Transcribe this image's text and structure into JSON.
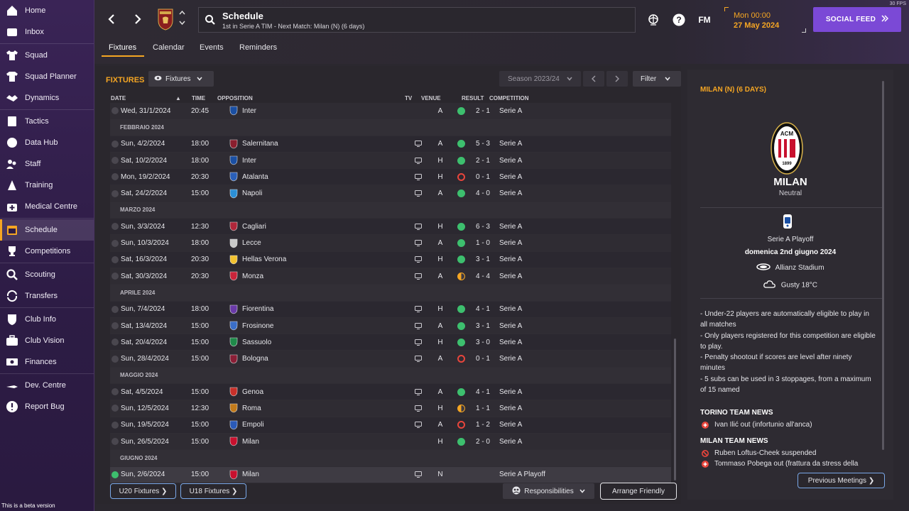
{
  "sidebar": {
    "items": [
      {
        "label": "Home",
        "icon": "home-icon"
      },
      {
        "label": "Inbox",
        "icon": "inbox-icon"
      },
      {
        "label": "Squad",
        "icon": "shirt-icon"
      },
      {
        "label": "Squad Planner",
        "icon": "planner-icon"
      },
      {
        "label": "Dynamics",
        "icon": "handshake-icon"
      },
      {
        "label": "Tactics",
        "icon": "tactics-board-icon"
      },
      {
        "label": "Data Hub",
        "icon": "data-hub-icon"
      },
      {
        "label": "Staff",
        "icon": "staff-icon"
      },
      {
        "label": "Training",
        "icon": "training-cone-icon"
      },
      {
        "label": "Medical Centre",
        "icon": "medical-kit-icon"
      },
      {
        "label": "Schedule",
        "icon": "calendar-icon"
      },
      {
        "label": "Competitions",
        "icon": "trophy-icon"
      },
      {
        "label": "Scouting",
        "icon": "magnifier-icon"
      },
      {
        "label": "Transfers",
        "icon": "transfer-arrows-icon"
      },
      {
        "label": "Club Info",
        "icon": "shield-icon"
      },
      {
        "label": "Club Vision",
        "icon": "briefcase-icon"
      },
      {
        "label": "Finances",
        "icon": "money-icon"
      },
      {
        "label": "Dev. Centre",
        "icon": "dev-centre-icon"
      },
      {
        "label": "Report Bug",
        "icon": "alert-icon"
      }
    ],
    "beta_text": "This is a beta version"
  },
  "header": {
    "title": "Schedule",
    "subtitle": "1st in Serie A TIM - Next Match: Milan (N) (6 days)",
    "fm_label": "FM",
    "time": "Mon 00:00",
    "date": "27 May 2024",
    "social_feed": "SOCIAL FEED",
    "fps": "30 FPS"
  },
  "tabs": [
    "Fixtures",
    "Calendar",
    "Events",
    "Reminders"
  ],
  "fixtures": {
    "title": "FIXTURES",
    "view_pill": "Fixtures",
    "season": "Season 2023/24",
    "filter": "Filter",
    "columns": {
      "date": "DATE",
      "time": "TIME",
      "opposition": "OPPOSITION",
      "tv": "TV",
      "venue": "VENUE",
      "result": "RESULT",
      "competition": "COMPETITION"
    },
    "rows": [
      {
        "type": "match",
        "date": "Wed, 31/1/2024",
        "time": "20:45",
        "opp": "Inter",
        "crest": "#1a4fa3",
        "tv": false,
        "venue": "A",
        "res": "win",
        "score": "2 - 1",
        "comp": "Serie A"
      },
      {
        "type": "month",
        "label": "FEBBRAIO 2024"
      },
      {
        "type": "match",
        "date": "Sun, 4/2/2024",
        "time": "18:00",
        "opp": "Salernitana",
        "crest": "#8b1e2e",
        "tv": true,
        "venue": "A",
        "res": "win",
        "score": "5 - 3",
        "comp": "Serie A"
      },
      {
        "type": "match",
        "date": "Sat, 10/2/2024",
        "time": "18:00",
        "opp": "Inter",
        "crest": "#1a4fa3",
        "tv": true,
        "venue": "H",
        "res": "win",
        "score": "2 - 1",
        "comp": "Serie A"
      },
      {
        "type": "match",
        "date": "Mon, 19/2/2024",
        "time": "20:30",
        "opp": "Atalanta",
        "crest": "#2a5fb8",
        "tv": true,
        "venue": "H",
        "res": "loss",
        "score": "0 - 1",
        "comp": "Serie A"
      },
      {
        "type": "match",
        "date": "Sat, 24/2/2024",
        "time": "15:00",
        "opp": "Napoli",
        "crest": "#2b8fd6",
        "tv": true,
        "venue": "A",
        "res": "win",
        "score": "4 - 0",
        "comp": "Serie A"
      },
      {
        "type": "month",
        "label": "MARZO 2024"
      },
      {
        "type": "match",
        "date": "Sun, 3/3/2024",
        "time": "12:30",
        "opp": "Cagliari",
        "crest": "#b0273a",
        "tv": true,
        "venue": "H",
        "res": "win",
        "score": "6 - 3",
        "comp": "Serie A"
      },
      {
        "type": "match",
        "date": "Sun, 10/3/2024",
        "time": "18:00",
        "opp": "Lecce",
        "crest": "#c9c9c9",
        "tv": true,
        "venue": "A",
        "res": "win",
        "score": "1 - 0",
        "comp": "Serie A"
      },
      {
        "type": "match",
        "date": "Sat, 16/3/2024",
        "time": "20:30",
        "opp": "Hellas Verona",
        "crest": "#f2c230",
        "tv": true,
        "venue": "H",
        "res": "win",
        "score": "3 - 1",
        "comp": "Serie A"
      },
      {
        "type": "match",
        "date": "Sat, 30/3/2024",
        "time": "20:30",
        "opp": "Monza",
        "crest": "#c8243a",
        "tv": true,
        "venue": "A",
        "res": "draw",
        "score": "4 - 4",
        "comp": "Serie A"
      },
      {
        "type": "month",
        "label": "APRILE 2024"
      },
      {
        "type": "match",
        "date": "Sun, 7/4/2024",
        "time": "18:00",
        "opp": "Fiorentina",
        "crest": "#6a3aa8",
        "tv": true,
        "venue": "H",
        "res": "win",
        "score": "4 - 1",
        "comp": "Serie A"
      },
      {
        "type": "match",
        "date": "Sat, 13/4/2024",
        "time": "15:00",
        "opp": "Frosinone",
        "crest": "#3a6ec8",
        "tv": true,
        "venue": "A",
        "res": "win",
        "score": "3 - 1",
        "comp": "Serie A"
      },
      {
        "type": "match",
        "date": "Sat, 20/4/2024",
        "time": "15:00",
        "opp": "Sassuolo",
        "crest": "#1f8a4a",
        "tv": true,
        "venue": "H",
        "res": "win",
        "score": "3 - 0",
        "comp": "Serie A"
      },
      {
        "type": "match",
        "date": "Sun, 28/4/2024",
        "time": "15:00",
        "opp": "Bologna",
        "crest": "#8a1e36",
        "tv": true,
        "venue": "A",
        "res": "loss",
        "score": "0 - 1",
        "comp": "Serie A"
      },
      {
        "type": "month",
        "label": "MAGGIO 2024"
      },
      {
        "type": "match",
        "date": "Sat, 4/5/2024",
        "time": "15:00",
        "opp": "Genoa",
        "crest": "#c8302a",
        "tv": true,
        "venue": "A",
        "res": "win",
        "score": "4 - 1",
        "comp": "Serie A"
      },
      {
        "type": "match",
        "date": "Sun, 12/5/2024",
        "time": "12:30",
        "opp": "Roma",
        "crest": "#c27a1a",
        "tv": true,
        "venue": "H",
        "res": "draw",
        "score": "1 - 1",
        "comp": "Serie A"
      },
      {
        "type": "match",
        "date": "Sun, 19/5/2024",
        "time": "15:00",
        "opp": "Empoli",
        "crest": "#2a5ab8",
        "tv": true,
        "venue": "A",
        "res": "loss",
        "score": "1 - 2",
        "comp": "Serie A"
      },
      {
        "type": "match",
        "date": "Sun, 26/5/2024",
        "time": "15:00",
        "opp": "Milan",
        "crest": "#c8102e",
        "tv": false,
        "venue": "H",
        "res": "win",
        "score": "2 - 0",
        "comp": "Serie A"
      },
      {
        "type": "month",
        "label": "GIUGNO 2024"
      },
      {
        "type": "match",
        "date": "Sun, 2/6/2024",
        "time": "15:00",
        "opp": "Milan",
        "crest": "#c8102e",
        "tv": true,
        "venue": "N",
        "res": "none",
        "score": "",
        "comp": "Serie A Playoff",
        "highlight": true
      }
    ],
    "u20_button": "U20 Fixtures ❯",
    "u18_button": "U18 Fixtures ❯",
    "responsibilities": "Responsibilities",
    "arrange_friendly": "Arrange Friendly"
  },
  "match_panel": {
    "title": "MILAN (N) (6 DAYS)",
    "team": "MILAN",
    "venue_type": "Neutral",
    "competition": "Serie A Playoff",
    "date": "domenica 2nd giugno 2024",
    "stadium": "Allianz Stadium",
    "weather": "Gusty 18°C",
    "crest_text": "ACM",
    "crest_year": "1899",
    "rules": [
      "- Under-22 players are automatically eligible to play in all matches",
      "- Only players registered for this competition are eligible to play.",
      "- Penalty shootout if scores are level after ninety minutes",
      "- 5 subs can be used in 3 stoppages, from a maximum of 15 named"
    ],
    "torino_news_title": "TORINO TEAM NEWS",
    "torino_news": [
      "Ivan Ilić out (infortunio all'anca)"
    ],
    "milan_news_title": "MILAN TEAM NEWS",
    "milan_news": [
      {
        "icon": "suspended-icon",
        "text": "Ruben Loftus-Cheek suspended"
      },
      {
        "icon": "injury-icon",
        "text": "Tommaso Pobega out (frattura da stress della"
      }
    ],
    "previous_meetings": "Previous Meetings ❯"
  },
  "colors": {
    "accent": "#f5a623",
    "win": "#3dbf6e",
    "loss": "#e8453c",
    "social": "#7b49d6"
  }
}
